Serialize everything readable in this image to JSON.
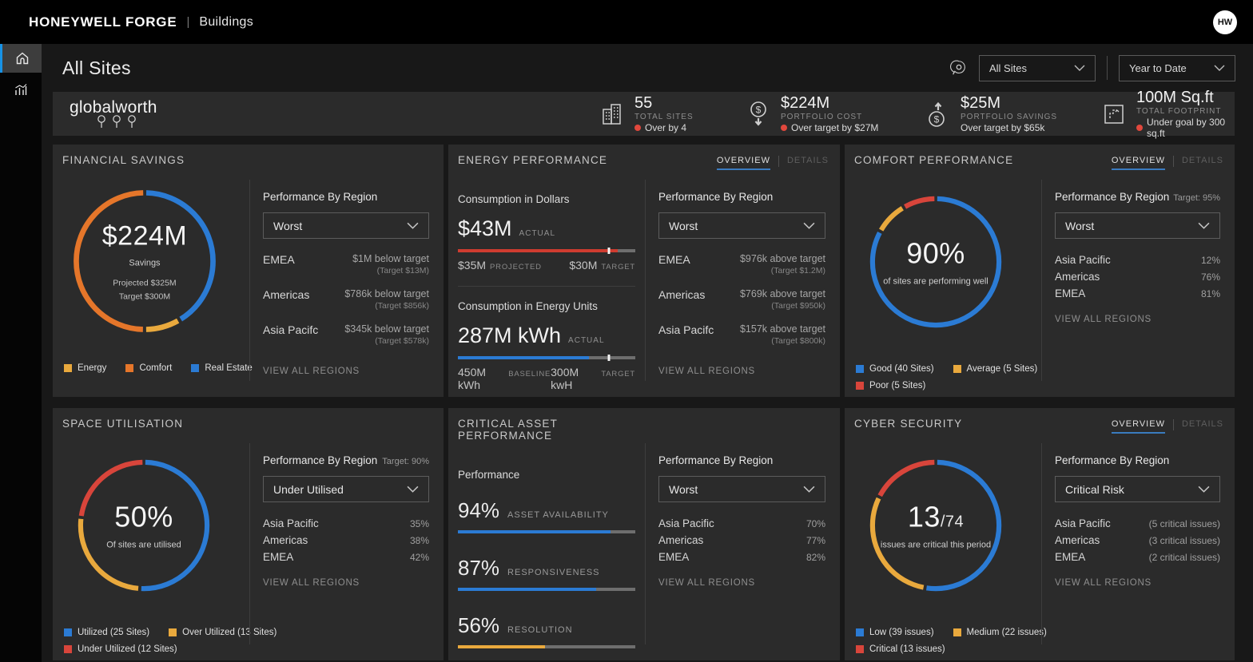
{
  "topbar": {
    "brand": "HONEYWELL FORGE",
    "separator": "|",
    "product": "Buildings",
    "avatar_initials": "HW"
  },
  "page_header": {
    "title": "All Sites",
    "site_filter": "All Sites",
    "period_filter": "Year to Date"
  },
  "banner": {
    "logo_text": "globalworth",
    "stats": [
      {
        "icon": "buildings-icon",
        "value": "55",
        "label": "TOTAL SITES",
        "status": "Over by 4",
        "alert_dot": true
      },
      {
        "icon": "portfolio-cost-icon",
        "value": "$224M",
        "label": "PORTFOLIO COST",
        "status": "Over target by $27M",
        "alert_dot": true
      },
      {
        "icon": "portfolio-savings-icon",
        "value": "$25M",
        "label": "PORTFOLIO SAVINGS",
        "status": "Over target by $65k",
        "alert_dot": false
      },
      {
        "icon": "footprint-icon",
        "value": "100M Sq.ft",
        "label": "TOTAL FOOTPRINT",
        "status": "Under goal by 300 sq.ft",
        "alert_dot": true
      }
    ]
  },
  "labels": {
    "performance_by_region": "Performance By Region",
    "view_all": "VIEW ALL REGIONS",
    "overview_tab": "OVERVIEW",
    "details_tab": "DETAILS"
  },
  "colors": {
    "blue": "#2b7bd4",
    "orange": "#e5762a",
    "yellow": "#e9a93d",
    "red": "#d8453b"
  },
  "cards": {
    "financial": {
      "title": "FINANCIAL SAVINGS",
      "donut": {
        "value": "$224M",
        "subtitle": "Savings",
        "note1": "Projected $325M",
        "note2": "Target $300M",
        "segments": [
          {
            "name": "Real Estate",
            "pct": 41.5,
            "color": "#2b7bd4"
          },
          {
            "name": "Energy",
            "pct": 8.5,
            "color": "#e9a93d"
          },
          {
            "name": "Comfort",
            "pct": 50,
            "color": "#e5762a"
          }
        ]
      },
      "legend": [
        {
          "label": "Energy",
          "color": "#e9a93d"
        },
        {
          "label": "Comfort",
          "color": "#e5762a"
        },
        {
          "label": "Real Estate",
          "color": "#2b7bd4"
        }
      ],
      "region_panel": {
        "filter": "Worst",
        "rows": [
          {
            "name": "EMEA",
            "value": "$1M below target",
            "sub": "(Target $13M)"
          },
          {
            "name": "Americas",
            "value": "$786k below target",
            "sub": "(Target $856k)"
          },
          {
            "name": "Asia Pacifc",
            "value": "$345k below target",
            "sub": "(Target $578k)"
          }
        ]
      }
    },
    "energy": {
      "title": "ENERGY PERFORMANCE",
      "sections": [
        {
          "heading": "Consumption in Dollars",
          "value": "$43M",
          "value_tag": "ACTUAL",
          "bar": {
            "color": "#cf3c30",
            "fill_pct": 90,
            "marker_pct": 85
          },
          "left_value": "$35M",
          "left_tag": "PROJECTED",
          "right_value": "$30M",
          "right_tag": "TARGET"
        },
        {
          "heading": "Consumption in Energy Units",
          "value": "287M kWh",
          "value_tag": "ACTUAL",
          "bar": {
            "color": "#2b7bd4",
            "fill_pct": 74,
            "marker_pct": 85
          },
          "left_value": "450M kWh",
          "left_tag": "BASELINE",
          "right_value": "300M kwH",
          "right_tag": "TARGET"
        }
      ],
      "region_panel": {
        "filter": "Worst",
        "rows": [
          {
            "name": "EMEA",
            "value": "$976k above target",
            "sub": "(Target $1.2M)"
          },
          {
            "name": "Americas",
            "value": "$769k above target",
            "sub": "(Target $950k)"
          },
          {
            "name": "Asia Pacifc",
            "value": "$157k above target",
            "sub": "(Target $800k)"
          }
        ]
      }
    },
    "comfort": {
      "title": "COMFORT PERFORMANCE",
      "donut": {
        "value": "90%",
        "subtitle": "of sites are performing well",
        "segments": [
          {
            "name": "Good",
            "pct": 83,
            "color": "#2b7bd4"
          },
          {
            "name": "Average",
            "pct": 8.5,
            "color": "#e9a93d"
          },
          {
            "name": "Poor",
            "pct": 8.5,
            "color": "#d8453b"
          }
        ]
      },
      "legend": [
        {
          "label": "Good (40 Sites)",
          "color": "#2b7bd4"
        },
        {
          "label": "Average (5 Sites)",
          "color": "#e9a93d"
        },
        {
          "label": "Poor (5 Sites)",
          "color": "#d8453b"
        }
      ],
      "region_panel": {
        "target": "Target: 95%",
        "filter": "Worst",
        "rows": [
          {
            "name": "Asia Pacific",
            "value": "12%"
          },
          {
            "name": "Americas",
            "value": "76%"
          },
          {
            "name": "EMEA",
            "value": "81%"
          }
        ]
      }
    },
    "space": {
      "title": "SPACE UTILISATION",
      "donut": {
        "value": "50%",
        "subtitle": "Of sites are utilised",
        "segments": [
          {
            "name": "Utilized",
            "pct": 51,
            "color": "#2b7bd4"
          },
          {
            "name": "Over Utilized",
            "pct": 26,
            "color": "#e9a93d"
          },
          {
            "name": "Under Utilized",
            "pct": 23,
            "color": "#d8453b"
          }
        ]
      },
      "legend": [
        {
          "label": "Utilized (25 Sites)",
          "color": "#2b7bd4"
        },
        {
          "label": "Over Utilized (13 Sites)",
          "color": "#e9a93d"
        },
        {
          "label": "Under Utilized (12 Sites)",
          "color": "#d8453b"
        }
      ],
      "region_panel": {
        "target": "Target: 90%",
        "filter": "Under Utilised",
        "rows": [
          {
            "name": "Asia Pacific",
            "value": "35%"
          },
          {
            "name": "Americas",
            "value": "38%"
          },
          {
            "name": "EMEA",
            "value": "42%"
          }
        ]
      }
    },
    "assets": {
      "title": "CRITICAL ASSET PERFORMANCE",
      "section_label": "Performance",
      "metrics": [
        {
          "value": "94%",
          "label": "ASSET AVAILABILITY",
          "bar": {
            "color": "#2b7bd4",
            "fill_pct": 86
          }
        },
        {
          "value": "87%",
          "label": "RESPONSIVENESS",
          "bar": {
            "color": "#2b7bd4",
            "fill_pct": 78
          }
        },
        {
          "value": "56%",
          "label": "RESOLUTION",
          "bar": {
            "color": "#e9a93d",
            "fill_pct": 49
          }
        }
      ],
      "region_panel": {
        "filter": "Worst",
        "rows": [
          {
            "name": "Asia Pacific",
            "value": "70%"
          },
          {
            "name": "Americas",
            "value": "77%"
          },
          {
            "name": "EMEA",
            "value": "82%"
          }
        ]
      }
    },
    "cyber": {
      "title": "CYBER SECURITY",
      "donut": {
        "value": "13",
        "denominator": "/74",
        "subtitle": "issues are critical this period",
        "segments": [
          {
            "name": "Low",
            "pct": 52.7,
            "color": "#2b7bd4"
          },
          {
            "name": "Medium",
            "pct": 29.7,
            "color": "#e9a93d"
          },
          {
            "name": "Critical",
            "pct": 17.6,
            "color": "#d8453b"
          }
        ]
      },
      "legend": [
        {
          "label": "Low (39 issues)",
          "color": "#2b7bd4"
        },
        {
          "label": "Medium (22 issues)",
          "color": "#e9a93d"
        },
        {
          "label": "Critical (13 issues)",
          "color": "#d8453b"
        }
      ],
      "region_panel": {
        "filter": "Critical Risk",
        "rows": [
          {
            "name": "Asia Pacific",
            "value": "(5 critical issues)"
          },
          {
            "name": "Americas",
            "value": "(3 critical issues)"
          },
          {
            "name": "EMEA",
            "value": "(2 critical issues)"
          }
        ]
      }
    }
  }
}
